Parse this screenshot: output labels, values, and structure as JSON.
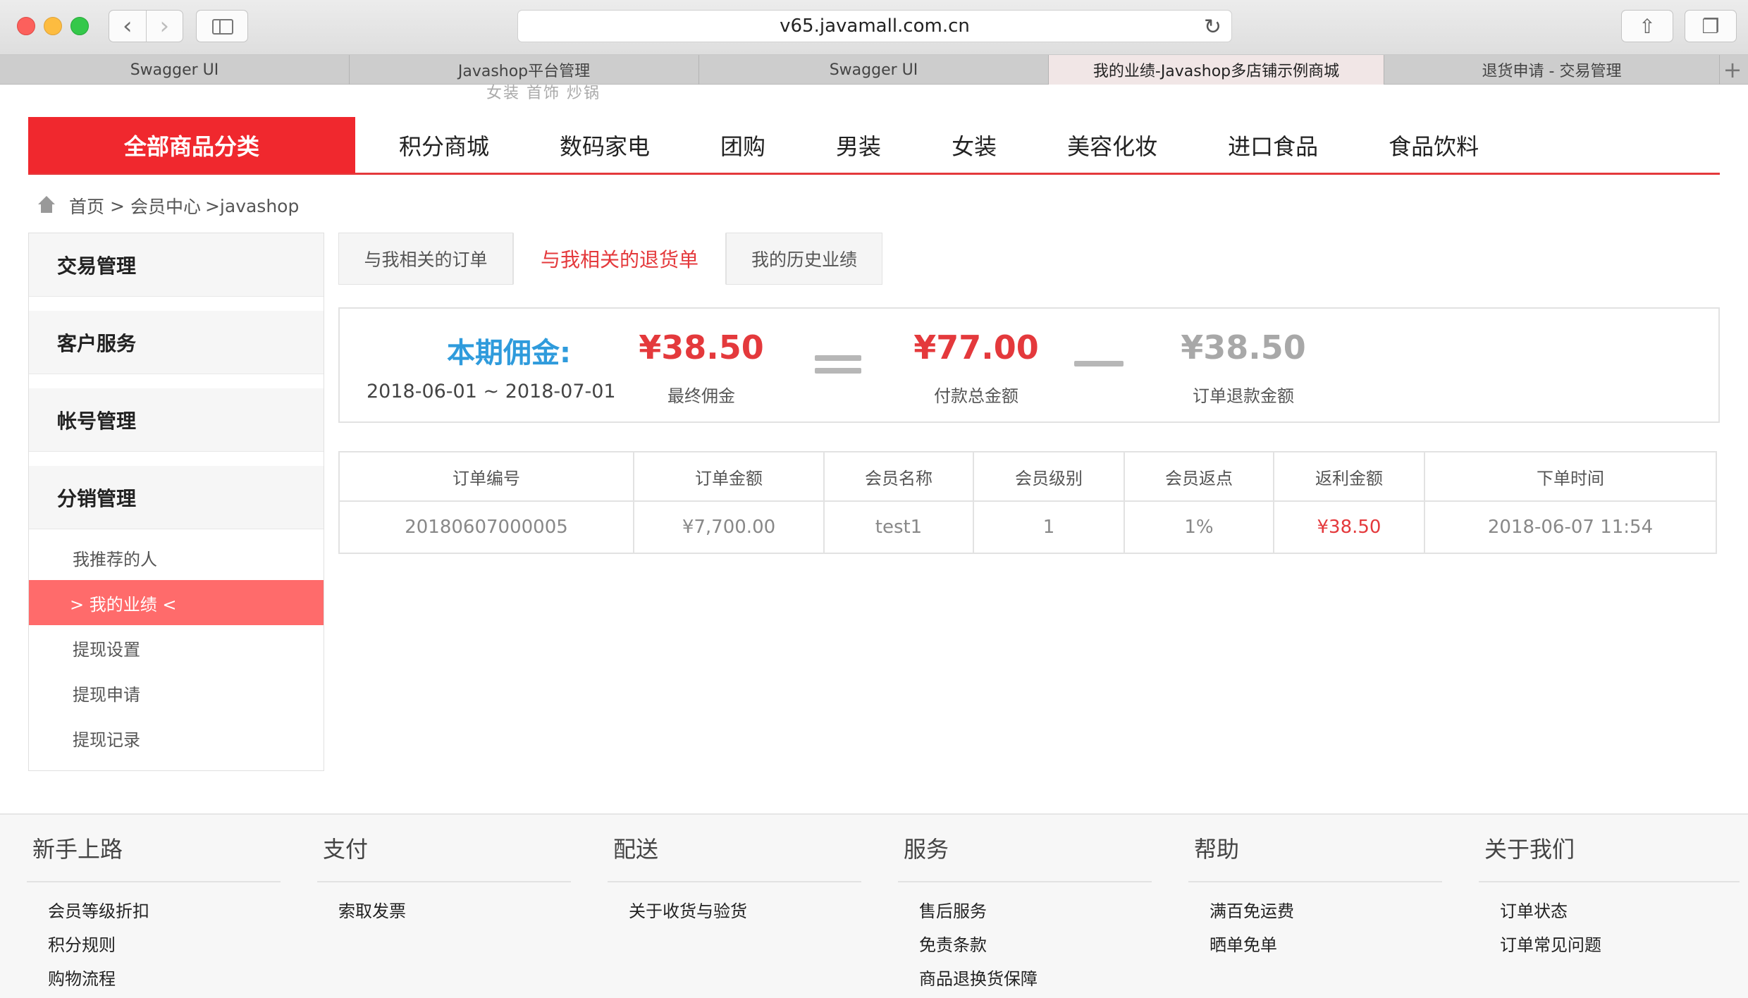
{
  "browser": {
    "url": "v65.javamall.com.cn",
    "tabs": [
      {
        "label": "Swagger UI"
      },
      {
        "label": "Javashop平台管理"
      },
      {
        "label": "Swagger UI"
      },
      {
        "label": "我的业绩-Javashop多店铺示例商城"
      },
      {
        "label": "退货申请 - 交易管理"
      }
    ]
  },
  "faded_text": "女装  首饰  炒锅",
  "category_nav": {
    "all_label": "全部商品分类",
    "items": [
      "积分商城",
      "数码家电",
      "团购",
      "男装",
      "女装",
      "美容化妆",
      "进口食品",
      "食品饮料"
    ]
  },
  "breadcrumb": {
    "home": "首页",
    "sep": ">",
    "member": "会员中心",
    "current": ">javashop"
  },
  "left_menu": {
    "groups": [
      "交易管理",
      "客户服务",
      "帐号管理",
      "分销管理"
    ],
    "sub_items": [
      "我推荐的人",
      "> 我的业绩 <",
      "提现设置",
      "提现申请",
      "提现记录"
    ]
  },
  "sub_tabs": [
    "与我相关的订单",
    "与我相关的退货单",
    "我的历史业绩"
  ],
  "summary": {
    "title": "本期佣金:",
    "period": "2018-06-01 ~ 2018-07-01",
    "final_value": "¥38.50",
    "final_label": "最终佣金",
    "total_value": "¥77.00",
    "total_label": "付款总金额",
    "refund_value": "¥38.50",
    "refund_label": "订单退款金额",
    "colors": {
      "title": "#2f9bdc",
      "red": "#e4393c",
      "gray": "#a8a8a8"
    }
  },
  "orders_table": {
    "headers": [
      "订单编号",
      "订单金额",
      "会员名称",
      "会员级别",
      "会员返点",
      "返利金额",
      "下单时间"
    ],
    "rows": [
      [
        "20180607000005",
        "¥7,700.00",
        "test1",
        "1",
        "1%",
        "¥38.50",
        "2018-06-07 11:54"
      ]
    ]
  },
  "footer": {
    "columns": [
      {
        "title": "新手上路",
        "links": [
          "会员等级折扣",
          "积分规则",
          "购物流程"
        ]
      },
      {
        "title": "支付",
        "links": [
          "索取发票"
        ]
      },
      {
        "title": "配送",
        "links": [
          "关于收货与验货"
        ]
      },
      {
        "title": "服务",
        "links": [
          "售后服务",
          "免责条款",
          "商品退换货保障"
        ]
      },
      {
        "title": "帮助",
        "links": [
          "满百免运费",
          "晒单免单"
        ]
      },
      {
        "title": "关于我们",
        "links": [
          "订单状态",
          "订单常见问题"
        ]
      }
    ]
  }
}
